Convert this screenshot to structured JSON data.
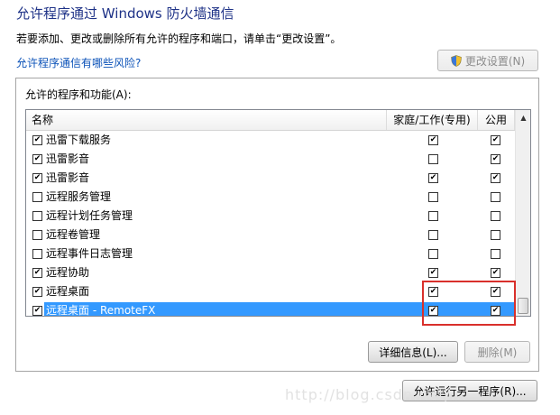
{
  "header": {
    "title": "允许程序通过 Windows 防火墙通信",
    "description": "若要添加、更改或删除所有允许的程序和端口，请单击“更改设置”。",
    "risk_link": "允许程序通信有哪些风险?",
    "change_settings_label": "更改设置(N)"
  },
  "group": {
    "label": "允许的程序和功能(A):",
    "columns": {
      "name": "名称",
      "home": "家庭/工作(专用)",
      "public": "公用"
    },
    "rows": [
      {
        "name": "迅雷下载服务",
        "enabled": "☑",
        "home": "✔",
        "public": "✔"
      },
      {
        "name": "迅雷影音",
        "enabled": "☑",
        "home": "",
        "public": "✔"
      },
      {
        "name": "迅雷影音",
        "enabled": "☑",
        "home": "✔",
        "public": "✔"
      },
      {
        "name": "远程服务管理",
        "enabled": "☐",
        "home": "",
        "public": ""
      },
      {
        "name": "远程计划任务管理",
        "enabled": "☐",
        "home": "",
        "public": ""
      },
      {
        "name": "远程卷管理",
        "enabled": "☐",
        "home": "",
        "public": ""
      },
      {
        "name": "远程事件日志管理",
        "enabled": "☐",
        "home": "",
        "public": ""
      },
      {
        "name": "远程协助",
        "enabled": "☑",
        "home": "✔",
        "public": "✔"
      },
      {
        "name": "远程桌面",
        "enabled": "☑",
        "home": "✔",
        "public": "✔"
      },
      {
        "name": "远程桌面 - RemoteFX",
        "enabled": "☑",
        "home": "✔",
        "public": "✔",
        "selected": true
      }
    ],
    "details_label": "详细信息(L)...",
    "delete_label": "删除(M)"
  },
  "footer": {
    "allow_another_label": "允许运行另一程序(R)..."
  },
  "watermark": "http://blog.csdn.net/...",
  "colors": {
    "title": "#1e3287",
    "link": "#0b52b8",
    "selection": "#3399ff",
    "highlight": "#d9302b"
  }
}
